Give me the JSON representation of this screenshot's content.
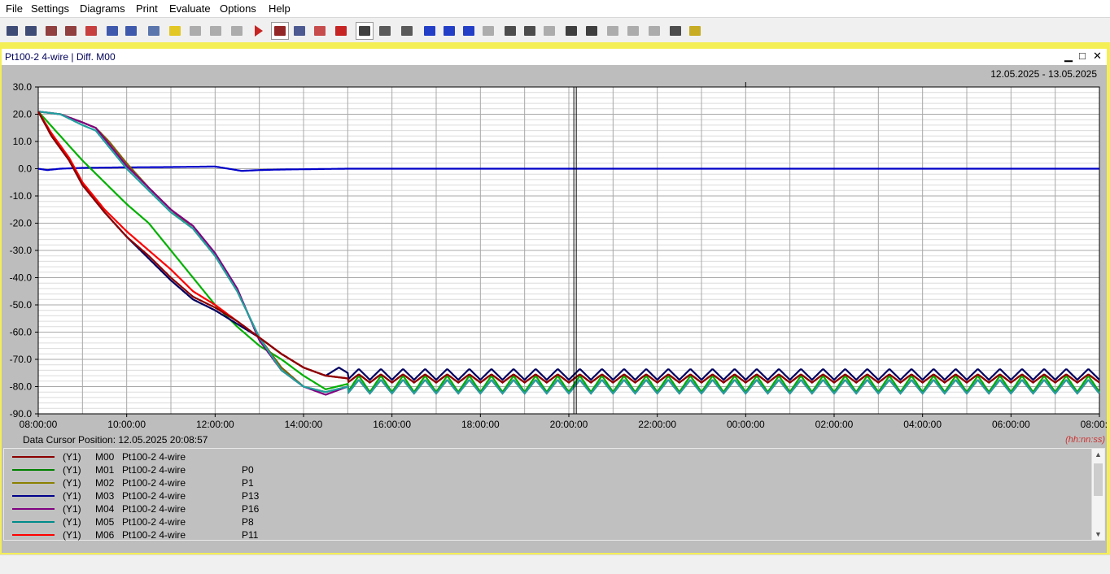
{
  "menu": [
    "File",
    "Settings",
    "Diagrams",
    "Print",
    "Evaluate",
    "Options",
    "Help"
  ],
  "toolbar_icons": [
    "new-window-icon",
    "open-window-icon",
    "table-window-icon",
    "add-window-icon",
    "bar-chart-icon",
    "table-icon",
    "table-color-icon",
    "copy-icon",
    "note-icon",
    "grid-layout-icon",
    "layout-icon",
    "arrow-right-icon",
    "play-icon",
    "stop-icon",
    "signal-icon",
    "cross-icon",
    "record-icon",
    "refresh-icon",
    "grid-icon",
    "zoom-fit-icon",
    "expand-horizontal-icon",
    "expand-vertical-icon",
    "undo-zoom-icon",
    "redo-zoom-icon",
    "print-icon",
    "print-preview-icon",
    "copy-window-icon",
    "text-ab-icon",
    "formula-icon",
    "limit-icon",
    "wave-icon",
    "pd-icon",
    "key-person-icon",
    "key-icon"
  ],
  "window": {
    "title": "Pt100-2 4-wire | Diff. M00",
    "minimize": "‗",
    "maximize": "□",
    "close": "✕"
  },
  "date_range": "12.05.2025 - 13.05.2025",
  "cursor_position_text": "Data Cursor Position: 12.05.2025 20:08:57",
  "time_unit": "(hh:nn:ss)",
  "legend": [
    {
      "axis": "(Y1)",
      "id": "M00",
      "name": "Pt100-2 4-wire",
      "label": "",
      "color": "#8b0000"
    },
    {
      "axis": "(Y1)",
      "id": "M01",
      "name": "Pt100-2 4-wire",
      "label": "P0",
      "color": "#008000"
    },
    {
      "axis": "(Y1)",
      "id": "M02",
      "name": "Pt100-2 4-wire",
      "label": "P1",
      "color": "#8b8000"
    },
    {
      "axis": "(Y1)",
      "id": "M03",
      "name": "Pt100-2 4-wire",
      "label": "P13",
      "color": "#00008b"
    },
    {
      "axis": "(Y1)",
      "id": "M04",
      "name": "Pt100-2 4-wire",
      "label": "P16",
      "color": "#800080"
    },
    {
      "axis": "(Y1)",
      "id": "M05",
      "name": "Pt100-2 4-wire",
      "label": "P8",
      "color": "#008b8b"
    },
    {
      "axis": "(Y1)",
      "id": "M06",
      "name": "Pt100-2 4-wire",
      "label": "P11",
      "color": "#ff0000"
    }
  ],
  "chart_data": {
    "type": "line",
    "title": "",
    "xlabel": "",
    "ylabel": "",
    "ylim": [
      -90,
      30
    ],
    "yticks": [
      30,
      20,
      10,
      0,
      -10,
      -20,
      -30,
      -40,
      -50,
      -60,
      -70,
      -80,
      -90
    ],
    "ytick_labels": [
      "30.0",
      "20.0",
      "10.0",
      "0.0",
      "-10.0",
      "-20.0",
      "-30.0",
      "-40.0",
      "-50.0",
      "-60.0",
      "-70.0",
      "-80.0",
      "-90.0"
    ],
    "xlim_hours": [
      8,
      32
    ],
    "xticks_hours": [
      8,
      10,
      12,
      14,
      16,
      18,
      20,
      22,
      24,
      26,
      28,
      30,
      32
    ],
    "xtick_labels": [
      "08:00:00",
      "10:00:00",
      "12:00:00",
      "14:00:00",
      "16:00:00",
      "18:00:00",
      "20:00:00",
      "22:00:00",
      "00:00:00",
      "02:00:00",
      "04:00:00",
      "06:00:00",
      "08:00:00"
    ],
    "cursor_hours": 20.15,
    "grid": true,
    "series": [
      {
        "id": "M00",
        "color": "#0000c8",
        "points": [
          [
            8,
            0
          ],
          [
            8.2,
            -0.5
          ],
          [
            8.5,
            0
          ],
          [
            9,
            0.3
          ],
          [
            10,
            0.5
          ],
          [
            11,
            0.6
          ],
          [
            12,
            0.8
          ],
          [
            12.3,
            0
          ],
          [
            12.6,
            -0.8
          ],
          [
            13,
            -0.5
          ],
          [
            13.5,
            -0.3
          ],
          [
            14,
            -0.2
          ],
          [
            15,
            0
          ],
          [
            32,
            0
          ]
        ]
      },
      {
        "id": "M01",
        "color": "#00b000",
        "points": [
          [
            8,
            21
          ],
          [
            8.5,
            12
          ],
          [
            9,
            3
          ],
          [
            9.5,
            -5
          ],
          [
            10,
            -13
          ],
          [
            10.5,
            -20
          ],
          [
            11,
            -30
          ],
          [
            11.5,
            -40
          ],
          [
            12,
            -50
          ],
          [
            12.5,
            -58
          ],
          [
            13,
            -65
          ],
          [
            13.5,
            -70
          ],
          [
            14,
            -76
          ],
          [
            14.5,
            -81
          ],
          [
            15,
            -79
          ],
          [
            32,
            -79
          ]
        ],
        "osc": {
          "center": -79,
          "amp": 3,
          "period": 0.5
        }
      },
      {
        "id": "M02",
        "color": "#806000",
        "points": [
          [
            8,
            21
          ],
          [
            8.5,
            20
          ],
          [
            9,
            17
          ],
          [
            9.3,
            15
          ],
          [
            9.6,
            10
          ],
          [
            10,
            2
          ],
          [
            10.5,
            -7
          ],
          [
            11,
            -15
          ],
          [
            11.5,
            -22
          ],
          [
            12,
            -32
          ],
          [
            12.5,
            -45
          ],
          [
            13,
            -62
          ],
          [
            13.5,
            -73
          ],
          [
            14,
            -80
          ],
          [
            14.5,
            -82
          ],
          [
            15,
            -80
          ],
          [
            32,
            -80
          ]
        ],
        "osc": {
          "center": -80,
          "amp": 2.5,
          "period": 0.5
        }
      },
      {
        "id": "M03",
        "color": "#000060",
        "points": [
          [
            8,
            21
          ],
          [
            8.3,
            12
          ],
          [
            8.7,
            3
          ],
          [
            9,
            -6
          ],
          [
            9.5,
            -16
          ],
          [
            10,
            -25
          ],
          [
            10.5,
            -33
          ],
          [
            11,
            -41
          ],
          [
            11.5,
            -48
          ],
          [
            12,
            -52
          ],
          [
            12.5,
            -57
          ],
          [
            13,
            -62
          ],
          [
            13.5,
            -68
          ],
          [
            14,
            -73
          ],
          [
            14.5,
            -76
          ],
          [
            14.8,
            -73
          ],
          [
            15,
            -75
          ],
          [
            32,
            -75
          ]
        ],
        "osc": {
          "center": -75.5,
          "amp": 2,
          "period": 0.5
        }
      },
      {
        "id": "M04",
        "color": "#800080",
        "points": [
          [
            8,
            21
          ],
          [
            8.5,
            20
          ],
          [
            9,
            17
          ],
          [
            9.3,
            15
          ],
          [
            9.6,
            9
          ],
          [
            10,
            1
          ],
          [
            10.5,
            -7
          ],
          [
            11,
            -15
          ],
          [
            11.5,
            -21
          ],
          [
            12,
            -31
          ],
          [
            12.5,
            -44
          ],
          [
            13,
            -63
          ],
          [
            13.5,
            -74
          ],
          [
            14,
            -80
          ],
          [
            14.5,
            -83
          ],
          [
            15,
            -80
          ],
          [
            32,
            -80
          ]
        ],
        "osc": {
          "center": -80,
          "amp": 2.5,
          "period": 0.5
        }
      },
      {
        "id": "M05",
        "color": "#20a0a0",
        "points": [
          [
            8,
            21
          ],
          [
            8.5,
            20
          ],
          [
            9,
            16
          ],
          [
            9.3,
            14
          ],
          [
            9.6,
            8
          ],
          [
            10,
            0
          ],
          [
            10.5,
            -8
          ],
          [
            11,
            -16
          ],
          [
            11.5,
            -22
          ],
          [
            12,
            -32
          ],
          [
            12.5,
            -45
          ],
          [
            13,
            -62
          ],
          [
            13.5,
            -74
          ],
          [
            14,
            -80
          ],
          [
            14.5,
            -82
          ],
          [
            15,
            -80
          ],
          [
            32,
            -80
          ]
        ],
        "osc": {
          "center": -80,
          "amp": 2.5,
          "period": 0.5
        }
      },
      {
        "id": "M06",
        "color": "#ff0000",
        "points": [
          [
            8,
            21
          ],
          [
            8.3,
            13
          ],
          [
            8.7,
            4
          ],
          [
            9,
            -5
          ],
          [
            9.5,
            -15
          ],
          [
            10,
            -23
          ],
          [
            10.5,
            -30
          ],
          [
            11,
            -37
          ],
          [
            11.5,
            -45
          ],
          [
            12,
            -50
          ],
          [
            12.5,
            -56
          ],
          [
            13,
            -62
          ],
          [
            13.5,
            -68
          ],
          [
            14,
            -73
          ],
          [
            14.5,
            -76
          ],
          [
            15,
            -77
          ],
          [
            32,
            -77
          ]
        ],
        "osc": {
          "center": -77,
          "amp": 1.5,
          "period": 0.5
        }
      },
      {
        "id": "M00b",
        "color": "#8b0000",
        "points": [
          [
            8,
            21
          ],
          [
            8.3,
            12
          ],
          [
            8.7,
            3
          ],
          [
            9,
            -6
          ],
          [
            9.5,
            -16
          ],
          [
            10,
            -25
          ],
          [
            10.5,
            -32
          ],
          [
            11,
            -40
          ],
          [
            11.5,
            -47
          ],
          [
            12,
            -51
          ],
          [
            12.5,
            -56
          ],
          [
            13,
            -62
          ],
          [
            13.5,
            -68
          ],
          [
            14,
            -73
          ],
          [
            14.5,
            -76
          ],
          [
            15,
            -77
          ],
          [
            32,
            -77
          ]
        ],
        "osc": {
          "center": -77,
          "amp": 1.5,
          "period": 0.5
        }
      }
    ]
  }
}
